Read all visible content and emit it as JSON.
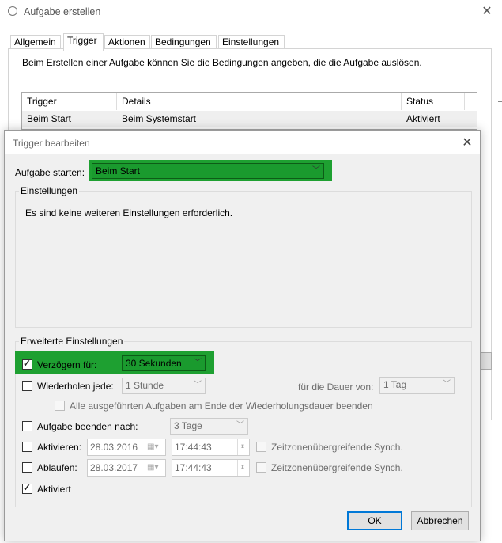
{
  "back_window": {
    "title": "Aufgabe erstellen",
    "tabs": [
      "Allgemein",
      "Trigger",
      "Aktionen",
      "Bedingungen",
      "Einstellungen"
    ],
    "description": "Beim Erstellen einer Aufgabe können Sie die Bedingungen angeben, die die Aufgabe auslösen.",
    "table": {
      "headers": [
        "Trigger",
        "Details",
        "Status"
      ],
      "rows": [
        [
          "Beim Start",
          "Beim Systemstart",
          "Aktiviert"
        ]
      ]
    }
  },
  "dialog": {
    "title": "Trigger bearbeiten",
    "start_label": "Aufgabe starten:",
    "start_value": "Beim Start",
    "settings_group": "Einstellungen",
    "settings_text": "Es sind keine weiteren Einstellungen erforderlich.",
    "advanced_group": "Erweiterte Einstellungen",
    "delay": {
      "label": "Verzögern für:",
      "checked": true,
      "value": "30 Sekunden"
    },
    "repeat": {
      "label": "Wiederholen jede:",
      "checked": false,
      "value": "1 Stunde",
      "duration_label": "für die Dauer von:",
      "duration_value": "1 Tag"
    },
    "stop_all": {
      "label": "Alle ausgeführten Aufgaben am Ende der Wiederholungsdauer beenden",
      "checked": false
    },
    "stop_after": {
      "label": "Aufgabe beenden nach:",
      "checked": false,
      "value": "3 Tage"
    },
    "activate": {
      "label": "Aktivieren:",
      "checked": false,
      "date": "28.03.2016",
      "time": "17:44:43",
      "sync_label": "Zeitzonenübergreifende Synch."
    },
    "expire": {
      "label": "Ablaufen:",
      "checked": false,
      "date": "28.03.2017",
      "time": "17:44:43",
      "sync_label": "Zeitzonenübergreifende Synch."
    },
    "enabled": {
      "label": "Aktiviert",
      "checked": true
    },
    "ok_label": "OK",
    "cancel_label": "Abbrechen"
  },
  "colors": {
    "highlight": "#1ea031",
    "default_button_border": "#0078d7"
  },
  "icons": [
    "clock-icon",
    "close-icon",
    "chevron-down-icon",
    "calendar-icon",
    "checkmark-icon"
  ]
}
